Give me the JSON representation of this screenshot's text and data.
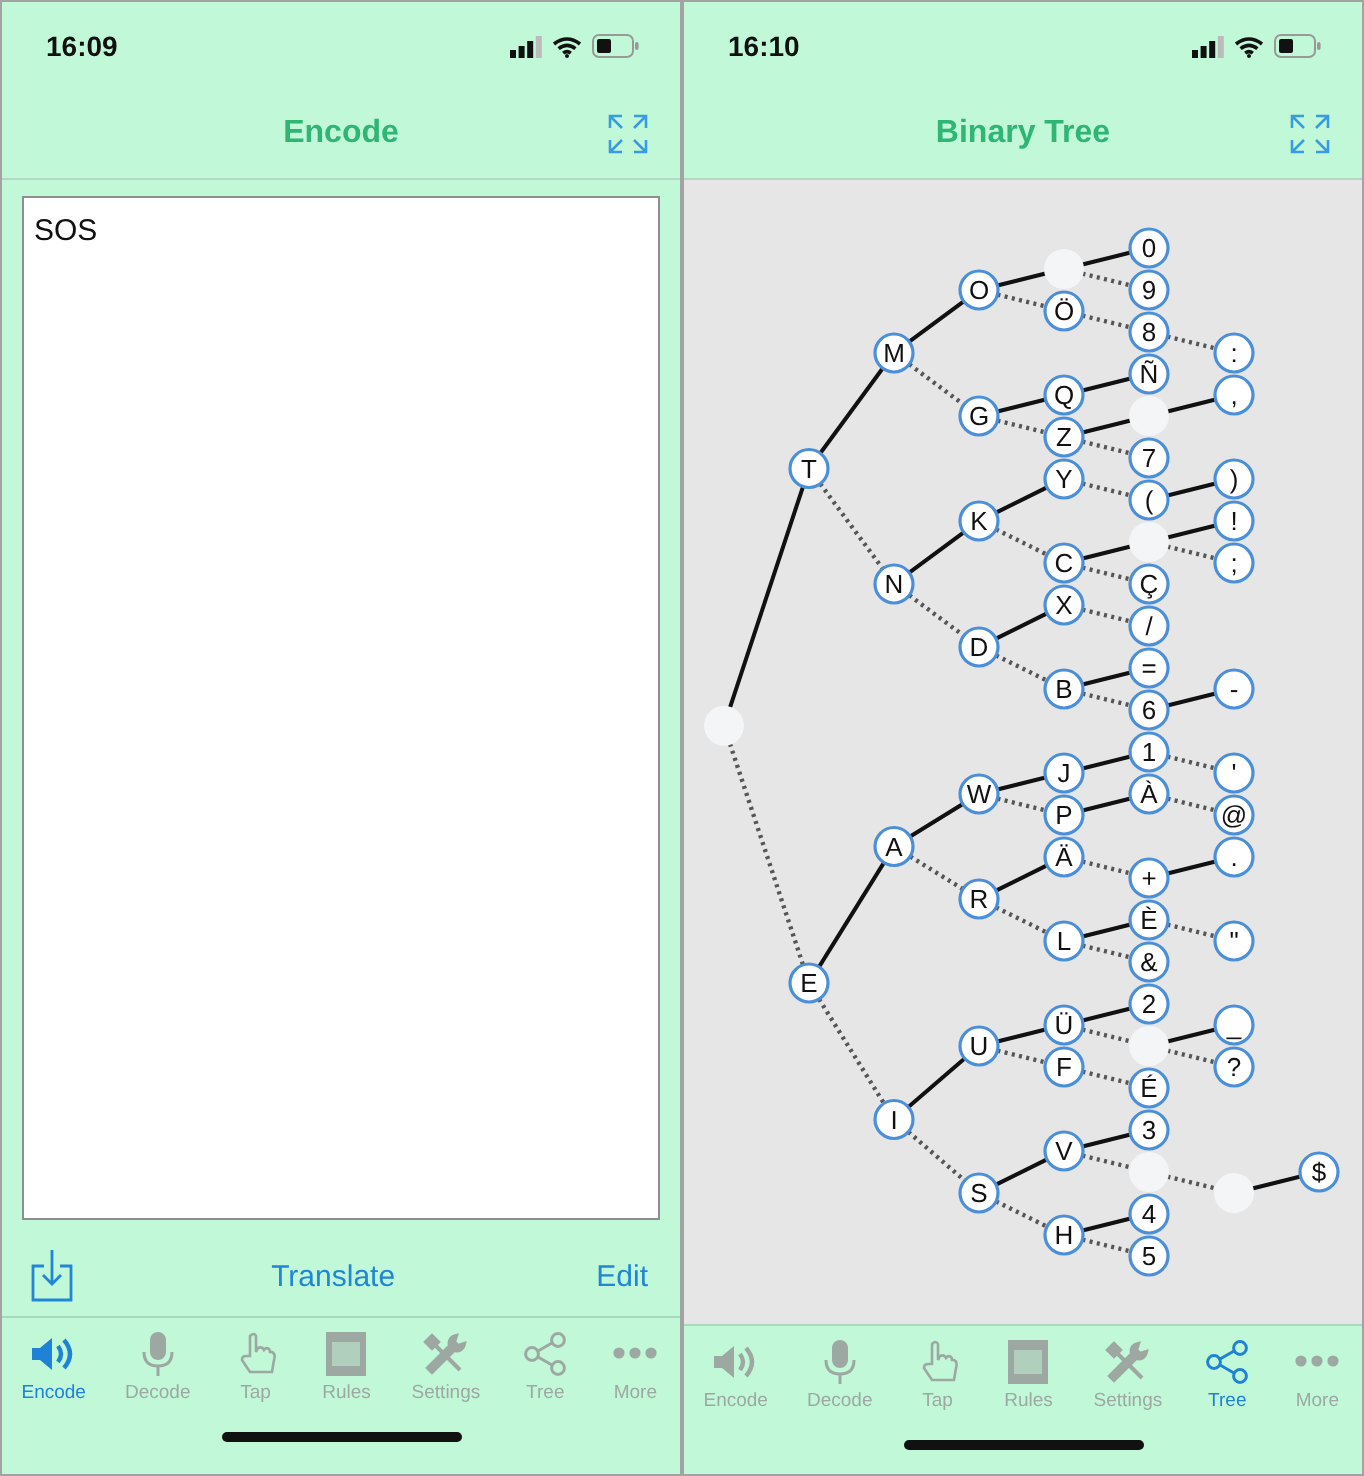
{
  "screens": [
    {
      "kind": "encode",
      "status": {
        "time": "16:09"
      },
      "title": "Encode",
      "text": "SOS",
      "toolbar": {
        "translate": "Translate",
        "edit": "Edit"
      },
      "tabs": [
        {
          "label": "Encode",
          "kind": "speaker",
          "selected": true
        },
        {
          "label": "Decode",
          "kind": "mic",
          "selected": false
        },
        {
          "label": "Tap",
          "kind": "hand",
          "selected": false
        },
        {
          "label": "Rules",
          "kind": "rules",
          "selected": false
        },
        {
          "label": "Settings",
          "kind": "tools",
          "selected": false
        },
        {
          "label": "Tree",
          "kind": "share",
          "selected": false
        },
        {
          "label": "More",
          "kind": "dots",
          "selected": false
        }
      ]
    },
    {
      "kind": "tree",
      "status": {
        "time": "16:10"
      },
      "title": "Binary Tree",
      "tree": {
        "children": [
          {
            "label": "T",
            "kind": "dash",
            "children": [
              {
                "label": "M",
                "kind": "dash",
                "children": [
                  {
                    "label": "O",
                    "kind": "dash",
                    "children": [
                      {
                        "kind": "dash",
                        "children": [
                          {
                            "label": "0",
                            "kind": "dash"
                          },
                          {
                            "label": "9",
                            "kind": "dot"
                          }
                        ]
                      },
                      {
                        "label": "Ö",
                        "kind": "dot",
                        "children": [
                          {
                            "label": "8",
                            "kind": "dot",
                            "children": [
                              {
                                "label": ":",
                                "kind": "dot"
                              }
                            ]
                          }
                        ]
                      }
                    ]
                  },
                  {
                    "label": "G",
                    "kind": "dot",
                    "children": [
                      {
                        "label": "Q",
                        "kind": "dash",
                        "children": [
                          {
                            "label": "Ñ",
                            "kind": "dash"
                          }
                        ]
                      },
                      {
                        "label": "Z",
                        "kind": "dot",
                        "children": [
                          {
                            "kind": "dash",
                            "children": [
                              {
                                "label": ",",
                                "kind": "dash"
                              }
                            ]
                          },
                          {
                            "label": "7",
                            "kind": "dot"
                          }
                        ]
                      }
                    ]
                  }
                ]
              },
              {
                "label": "N",
                "kind": "dot",
                "children": [
                  {
                    "label": "K",
                    "kind": "dash",
                    "children": [
                      {
                        "label": "Y",
                        "kind": "dash",
                        "children": [
                          {
                            "label": "(",
                            "kind": "dot",
                            "children": [
                              {
                                "label": ")",
                                "kind": "dash"
                              }
                            ]
                          }
                        ]
                      },
                      {
                        "label": "C",
                        "kind": "dot",
                        "children": [
                          {
                            "kind": "dash",
                            "children": [
                              {
                                "label": "!",
                                "kind": "dash"
                              },
                              {
                                "label": ";",
                                "kind": "dot"
                              }
                            ]
                          },
                          {
                            "label": "Ç",
                            "kind": "dot"
                          }
                        ]
                      }
                    ]
                  },
                  {
                    "label": "D",
                    "kind": "dot",
                    "children": [
                      {
                        "label": "X",
                        "kind": "dash",
                        "children": [
                          {
                            "label": "/",
                            "kind": "dot"
                          }
                        ]
                      },
                      {
                        "label": "B",
                        "kind": "dot",
                        "children": [
                          {
                            "label": "=",
                            "kind": "dash"
                          },
                          {
                            "label": "6",
                            "kind": "dot",
                            "children": [
                              {
                                "label": "-",
                                "kind": "dash"
                              }
                            ]
                          }
                        ]
                      }
                    ]
                  }
                ]
              }
            ]
          },
          {
            "label": "E",
            "kind": "dot",
            "children": [
              {
                "label": "A",
                "kind": "dash",
                "children": [
                  {
                    "label": "W",
                    "kind": "dash",
                    "children": [
                      {
                        "label": "J",
                        "kind": "dash",
                        "children": [
                          {
                            "label": "1",
                            "kind": "dash",
                            "children": [
                              {
                                "label": "'",
                                "kind": "dot"
                              }
                            ]
                          }
                        ]
                      },
                      {
                        "label": "P",
                        "kind": "dot",
                        "children": [
                          {
                            "label": "À",
                            "kind": "dash",
                            "children": [
                              {
                                "label": "@",
                                "kind": "dot"
                              }
                            ]
                          }
                        ]
                      }
                    ]
                  },
                  {
                    "label": "R",
                    "kind": "dot",
                    "children": [
                      {
                        "label": "Ä",
                        "kind": "dash",
                        "children": [
                          {
                            "label": "+",
                            "kind": "dot",
                            "children": [
                              {
                                "label": ".",
                                "kind": "dash"
                              }
                            ]
                          }
                        ]
                      },
                      {
                        "label": "L",
                        "kind": "dot",
                        "children": [
                          {
                            "label": "È",
                            "kind": "dash",
                            "children": [
                              {
                                "label": "\"",
                                "kind": "dot"
                              }
                            ]
                          },
                          {
                            "label": "&",
                            "kind": "dot"
                          }
                        ]
                      }
                    ]
                  }
                ]
              },
              {
                "label": "I",
                "kind": "dot",
                "children": [
                  {
                    "label": "U",
                    "kind": "dash",
                    "children": [
                      {
                        "label": "Ü",
                        "kind": "dash",
                        "children": [
                          {
                            "label": "2",
                            "kind": "dash"
                          },
                          {
                            "kind": "dot",
                            "children": [
                              {
                                "label": "_",
                                "kind": "dash"
                              },
                              {
                                "label": "?",
                                "kind": "dot"
                              }
                            ]
                          }
                        ]
                      },
                      {
                        "label": "F",
                        "kind": "dot",
                        "children": [
                          {
                            "label": "É",
                            "kind": "dot"
                          }
                        ]
                      }
                    ]
                  },
                  {
                    "label": "S",
                    "kind": "dot",
                    "children": [
                      {
                        "label": "V",
                        "kind": "dash",
                        "children": [
                          {
                            "label": "3",
                            "kind": "dash"
                          },
                          {
                            "kind": "dot",
                            "children": [
                              {
                                "kind": "dot",
                                "children": [
                                  {
                                    "label": "$",
                                    "kind": "dash"
                                  }
                                ]
                              }
                            ]
                          }
                        ]
                      },
                      {
                        "label": "H",
                        "kind": "dot",
                        "children": [
                          {
                            "label": "4",
                            "kind": "dash"
                          },
                          {
                            "label": "5",
                            "kind": "dot"
                          }
                        ]
                      }
                    ]
                  }
                ]
              }
            ]
          }
        ]
      },
      "tabs": [
        {
          "label": "Encode",
          "kind": "speaker",
          "selected": false
        },
        {
          "label": "Decode",
          "kind": "mic",
          "selected": false
        },
        {
          "label": "Tap",
          "kind": "hand",
          "selected": false
        },
        {
          "label": "Rules",
          "kind": "rules",
          "selected": false
        },
        {
          "label": "Settings",
          "kind": "tools",
          "selected": false
        },
        {
          "label": "Tree",
          "kind": "share",
          "selected": true
        },
        {
          "label": "More",
          "kind": "dots",
          "selected": false
        }
      ]
    }
  ]
}
